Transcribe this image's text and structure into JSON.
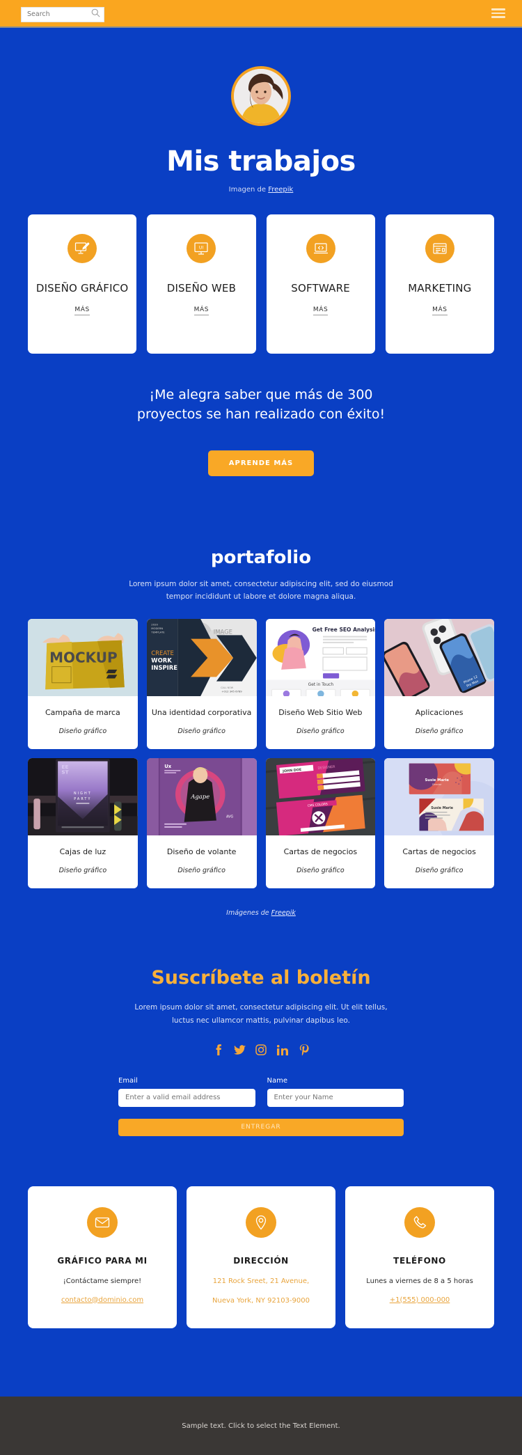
{
  "topbar": {
    "search_placeholder": "Search",
    "search_value": "",
    "search_icon": "search-icon",
    "menu_icon": "hamburger-menu-icon"
  },
  "hero": {
    "title": "Mis trabajos",
    "credit_prefix": "Imagen de ",
    "credit_link": "Freepik",
    "avatar_alt": "avatar"
  },
  "services": [
    {
      "icon": "graphic-design-icon",
      "title": "DISEÑO GRÁFICO",
      "more": "MÁS"
    },
    {
      "icon": "ui-monitor-icon",
      "title": "DISEÑO WEB",
      "more": "MÁS"
    },
    {
      "icon": "code-laptop-icon",
      "title": "SOFTWARE",
      "more": "MÁS"
    },
    {
      "icon": "browser-window-icon",
      "title": "MARKETING",
      "more": "MÁS"
    }
  ],
  "cta": {
    "text": "¡Me alegra saber que más de 300 proyectos se han realizado con éxito!",
    "button": "APRENDE MÁS"
  },
  "portfolio": {
    "title": "portafolio",
    "subtitle": "Lorem ipsum dolor sit amet, consectetur adipiscing elit, sed do eiusmod tempor incididunt ut labore et dolore magna aliqua.",
    "credit_prefix": "Imágenes de ",
    "credit_link": "Freepik",
    "items": [
      {
        "name": "Campaña de marca",
        "category": "Diseño gráfico",
        "thumb": "mockup-yellow-bag"
      },
      {
        "name": "Una identidad corporativa",
        "category": "Diseño gráfico",
        "thumb": "corporate-brochure"
      },
      {
        "name": "Diseño Web Sitio Web",
        "category": "Diseño gráfico",
        "thumb": "seo-landing-page"
      },
      {
        "name": "Aplicaciones",
        "category": "Diseño gráfico",
        "thumb": "phone-mockups"
      },
      {
        "name": "Cajas de luz",
        "category": "Diseño gráfico",
        "thumb": "night-party-lightbox"
      },
      {
        "name": "Diseño de volante",
        "category": "Diseño gráfico",
        "thumb": "purple-flyer"
      },
      {
        "name": "Cartas de negocios",
        "category": "Diseño gráfico",
        "thumb": "pink-business-cards"
      },
      {
        "name": "Cartas de negocios",
        "category": "Diseño gráfico",
        "thumb": "pastel-business-cards"
      }
    ]
  },
  "newsletter": {
    "title": "Suscríbete al boletín",
    "subtitle": "Lorem ipsum dolor sit amet, consectetur adipiscing elit. Ut elit tellus, luctus nec ullamcor mattis, pulvinar dapibus leo.",
    "socials": [
      "facebook-icon",
      "twitter-icon",
      "instagram-icon",
      "linkedin-icon",
      "pinterest-icon"
    ],
    "email_label": "Email",
    "email_placeholder": "Enter a valid email address",
    "email_value": "",
    "name_label": "Name",
    "name_placeholder": "Enter your Name",
    "name_value": "",
    "submit": "ENTREGAR"
  },
  "contacts": [
    {
      "icon": "envelope-icon",
      "title": "GRÁFICO PARA MI",
      "line1": "¡Contáctame siempre!",
      "link": "contacto@dominio.com",
      "line1_accent": false
    },
    {
      "icon": "location-pin-icon",
      "title": "DIRECCIÓN",
      "line1": "121 Rock Sreet, 21 Avenue,",
      "link": "Nueva York, NY 92103-9000",
      "line1_accent": true
    },
    {
      "icon": "phone-icon",
      "title": "TELÉFONO",
      "line1": "Lunes a viernes de 8 a 5 horas",
      "link": "+1(555) 000-000",
      "line1_accent": false
    }
  ],
  "footer": {
    "text": "Sample text. Click to select the Text Element."
  },
  "colors": {
    "brand_blue": "#0a3fc4",
    "accent_orange": "#f2a122",
    "topbar_orange": "#faa61f",
    "footer_gray": "#3a3735",
    "card_white": "#ffffff"
  }
}
